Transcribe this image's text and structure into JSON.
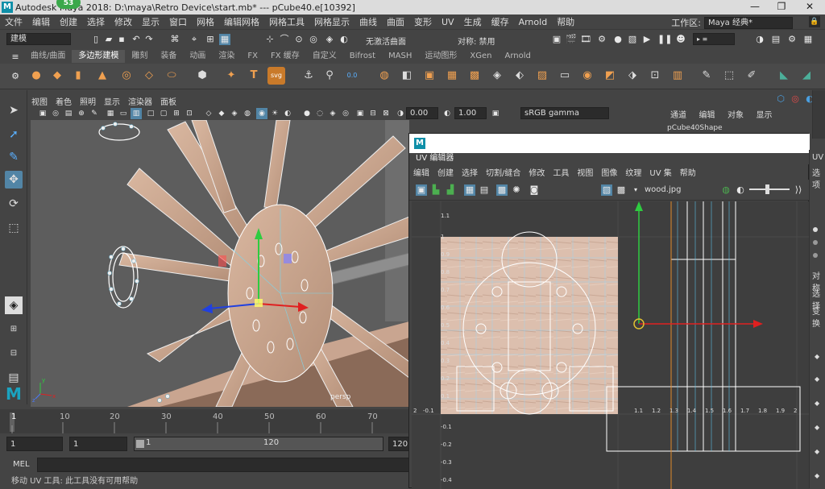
{
  "titlebar": {
    "title": "Autodesk Maya 2018: D:\\maya\\Retro Device\\start.mb*   ---   pCube40.e[10392]",
    "badge": "53",
    "minimize": "—",
    "restore": "❐",
    "close": "✕"
  },
  "menubar": {
    "items": [
      "文件",
      "编辑",
      "创建",
      "选择",
      "修改",
      "显示",
      "窗口",
      "网格",
      "编辑网格",
      "网格工具",
      "网格显示",
      "曲线",
      "曲面",
      "变形",
      "UV",
      "生成",
      "缓存",
      "Arnold",
      "帮助"
    ],
    "workspace_label": "工作区:",
    "workspace_value": "Maya 经典*"
  },
  "statusline": {
    "mode": "建模",
    "live_surface": "无激活曲面",
    "symmetry": "对称: 禁用"
  },
  "shelf": {
    "tabs": [
      "曲线/曲面",
      "多边形建模",
      "雕刻",
      "装备",
      "动画",
      "渲染",
      "FX",
      "FX 缓存",
      "自定义",
      "Bifrost",
      "MASH",
      "运动图形",
      "XGen",
      "Arnold"
    ],
    "active_tab": "多边形建模"
  },
  "viewport": {
    "menu": [
      "视图",
      "着色",
      "照明",
      "显示",
      "渲染器",
      "面板"
    ],
    "exposure": "0.00",
    "gamma": "1.00",
    "colorspace": "sRGB gamma",
    "camera_label": "persp"
  },
  "rightpanel": {
    "menu": [
      "通道",
      "编辑",
      "对象",
      "显示"
    ],
    "shape_name": "pCube40Shape"
  },
  "uv_editor": {
    "title": "UV 编辑器",
    "menu": [
      "编辑",
      "创建",
      "选择",
      "切割/缝合",
      "修改",
      "工具",
      "视图",
      "图像",
      "纹理",
      "UV 集",
      "帮助"
    ],
    "texture": "wood.jpg",
    "y_labels": [
      "1.1",
      "1",
      "0.9",
      "0.8",
      "0.7",
      "0.6",
      "0.5",
      "0.4",
      "0.3",
      "0.2",
      "0.1",
      "-0.1",
      "-0.2",
      "-0.3",
      "-0.4"
    ],
    "x_labels": [
      "-0.1",
      "1.1",
      "1.2",
      "1.3",
      "1.4",
      "1.5",
      "1.6",
      "1.7",
      "1.8",
      "1.9",
      "2"
    ],
    "x_origin_label": "2",
    "side_labels": [
      "UV",
      "选项",
      "对称",
      "选择",
      "变换"
    ]
  },
  "timeline": {
    "ticks": [
      "1",
      "10",
      "20",
      "30",
      "40",
      "50",
      "60",
      "70"
    ],
    "current": "1",
    "start": "1",
    "range_start": "1",
    "range_inner_start": "1",
    "range_inner_end": "120",
    "range_end": "120"
  },
  "cmdline": {
    "label": "MEL"
  },
  "helpline": {
    "text": "移动 UV 工具: 此工具没有可用帮助"
  }
}
